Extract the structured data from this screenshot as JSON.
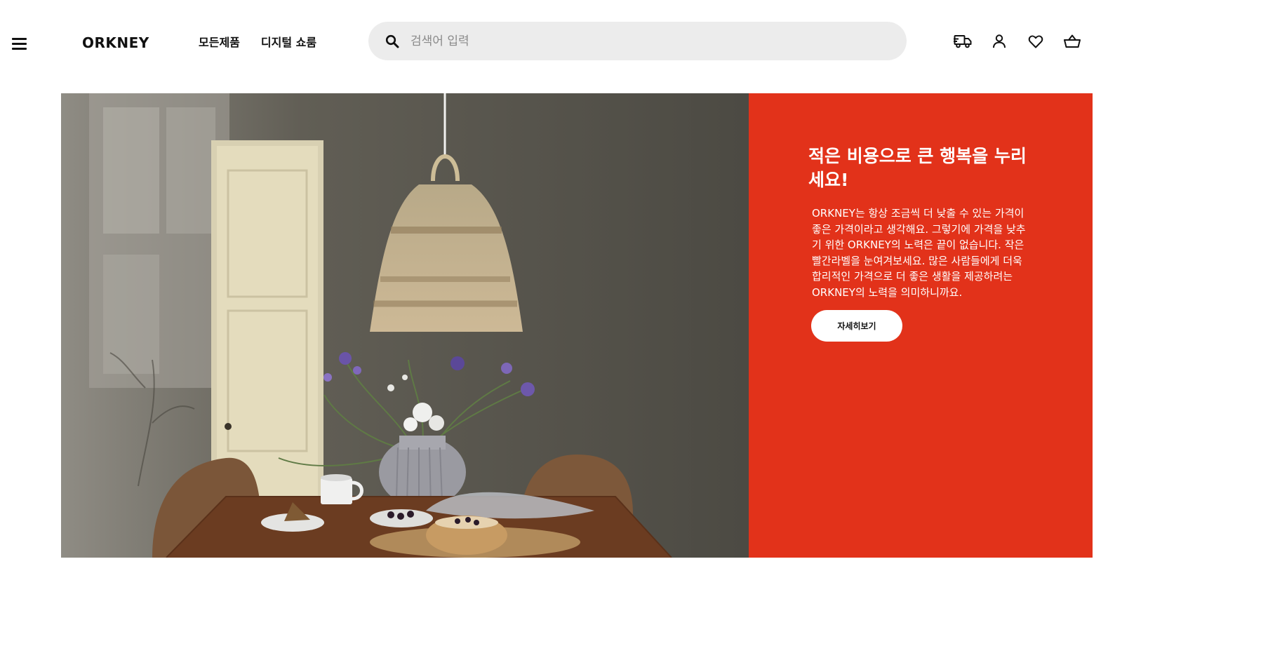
{
  "header": {
    "logo": "ORKNEY",
    "nav": [
      {
        "label": "모든제품"
      },
      {
        "label": "디지털 쇼룸"
      }
    ],
    "search": {
      "placeholder": "검색어 입력",
      "value": ""
    },
    "icons": [
      "menu-icon",
      "search-icon",
      "delivery-truck-icon",
      "user-icon",
      "heart-icon",
      "shopping-basket-icon"
    ]
  },
  "hero": {
    "title": "적은 비용으로 큰 행복을 누리세요!",
    "body": "ORKNEY는 항상 조금씩 더 낮출 수 있는 가격이 좋은 가격이라고 생각해요. 그렇기에 가격을 낮추기 위한 ORKNEY의 노력은 끝이 없습니다. 작은 빨간라벨을 눈여겨보세요. 많은 사람들에게 더욱 합리적인 가격으로 더 좋은 생활을 제공하려는 ORKNEY의 노력을 의미하니까요.",
    "cta_label": "자세히보기",
    "panel_color": "#e2321a"
  }
}
